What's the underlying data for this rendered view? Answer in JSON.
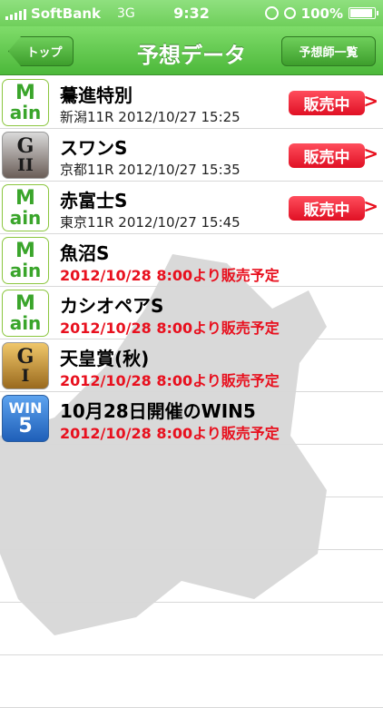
{
  "statusbar": {
    "carrier": "SoftBank",
    "network": "3G",
    "time": "9:32",
    "battery": "100%"
  },
  "navbar": {
    "back_label": "トップ",
    "title": "予想データ",
    "right_label": "予想師一覧"
  },
  "colors": {
    "nav_green": "#4cb83a",
    "sale_red": "#e8101e"
  },
  "races": [
    {
      "badge": "main",
      "title": "驀進特別",
      "subtitle": "新潟11R 2012/10/27 15:25",
      "status": "販売中",
      "on_sale": true
    },
    {
      "badge": "G2",
      "title": "スワンS",
      "subtitle": "京都11R 2012/10/27 15:35",
      "status": "販売中",
      "on_sale": true
    },
    {
      "badge": "main",
      "title": "赤富士S",
      "subtitle": "東京11R 2012/10/27 15:45",
      "status": "販売中",
      "on_sale": true
    },
    {
      "badge": "main",
      "title": "魚沼S",
      "subtitle": "2012/10/28 8:00より販売予定",
      "on_sale": false
    },
    {
      "badge": "main",
      "title": "カシオペアS",
      "subtitle": "2012/10/28 8:00より販売予定",
      "on_sale": false
    },
    {
      "badge": "G1",
      "title": "天皇賞(秋)",
      "subtitle": "2012/10/28 8:00より販売予定",
      "on_sale": false
    },
    {
      "badge": "WIN5",
      "title": "10月28日開催のWIN5",
      "subtitle": "2012/10/28 8:00より販売予定",
      "on_sale": false
    }
  ],
  "badges": {
    "main_top": "M",
    "main_bottom": "ain",
    "g_letter": "G",
    "g2_num": "II",
    "g1_num": "I",
    "win_top": "WIN",
    "win_bottom": "5"
  },
  "chevron": ">"
}
